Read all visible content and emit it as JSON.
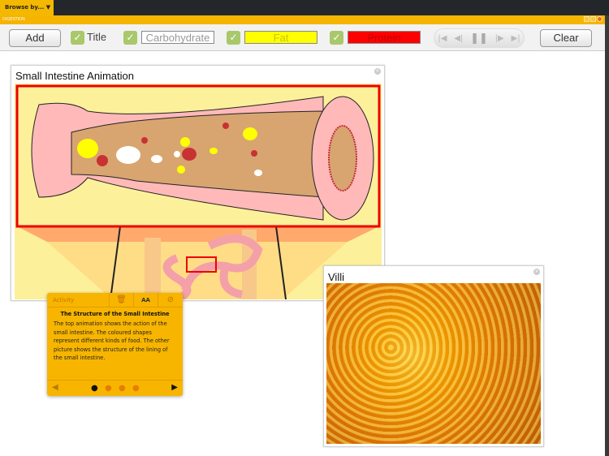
{
  "topbar": {
    "browse_label": "Browse by...",
    "window_title": "DIGESTION"
  },
  "toolbar": {
    "add_label": "Add",
    "title_label": "Title",
    "carb_label": "Carbohydrate",
    "fat_label": "Fat",
    "protein_label": "Protein",
    "clear_label": "Clear",
    "carb_color": "#ffffff",
    "fat_color": "#ffff00",
    "protein_color": "#ff0000",
    "check_color": "#a9c86b"
  },
  "panel_animation": {
    "title": "Small Intestine Animation"
  },
  "panel_villi": {
    "title": "Villi"
  },
  "activity": {
    "header": "Activity",
    "font_size_label": "AA",
    "title": "The Structure of the Small Intestine",
    "text": "The top animation shows the action of the small intestine. The coloured shapes represent different kinds of food. The other picture shows the structure of the lining of the small intestine.",
    "page": 1,
    "page_count": 4
  }
}
